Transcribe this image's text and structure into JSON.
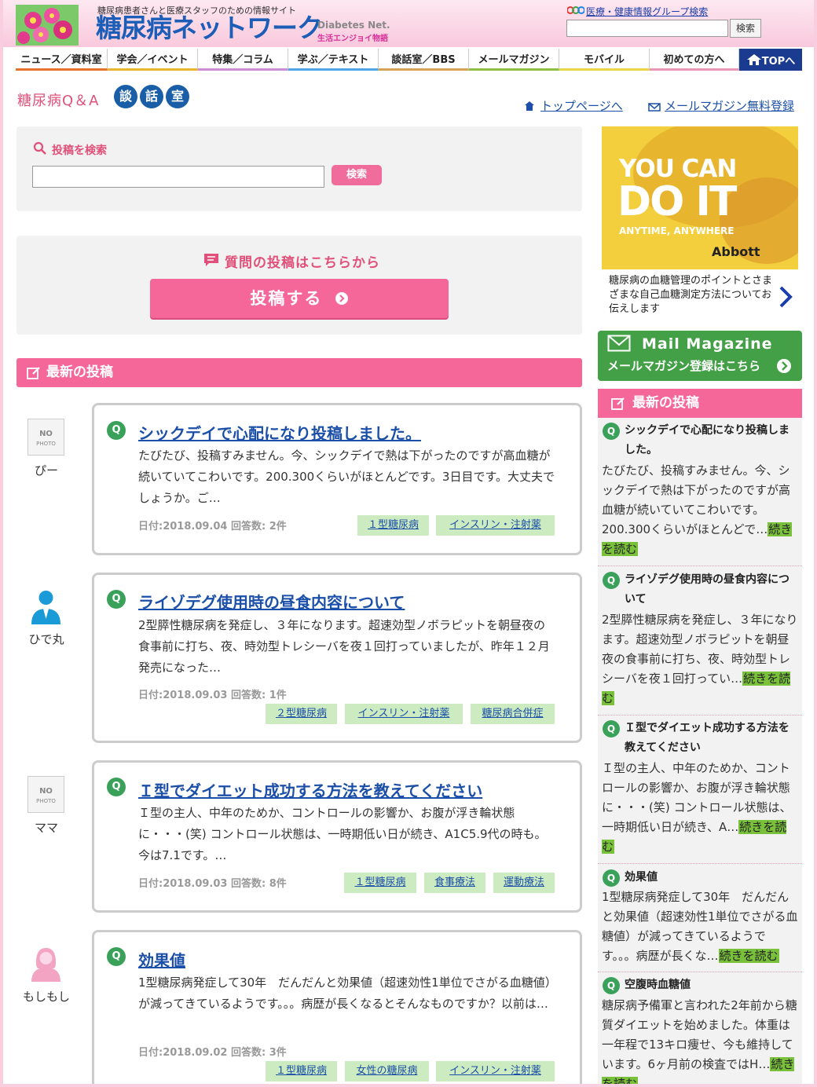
{
  "header": {
    "tagline": "糖尿病患者さんと医療スタッフのための情報サイト",
    "site_name": "糖尿病ネットワーク",
    "sub_en": "Diabetes Net.",
    "sub_jp": "生活エンジョイ物語",
    "group_search_label": "医療・健康情報グループ検索",
    "search_button": "検索"
  },
  "nav": {
    "items": [
      "ニュース／資料室",
      "学会／イベント",
      "特集／コラム",
      "学ぶ／テキスト",
      "談話室／BBS",
      "メールマガジン",
      "モバイル",
      "初めての方へ"
    ],
    "top": "TOPへ",
    "accent_colors": [
      "#e5732d",
      "#e8b62f",
      "#c98fd1",
      "#4fa6e6",
      "#d6a356",
      "#8fc046",
      "#e9d648",
      "#e898b6"
    ]
  },
  "page": {
    "title_prefix": "糖尿病Q＆A",
    "title_chars": [
      "談",
      "話",
      "室"
    ],
    "top_link": "トップページへ",
    "mail_link": "メールマガジン無料登録"
  },
  "search_box": {
    "label": "投稿を検索",
    "button": "検索"
  },
  "post_box": {
    "label": "質問の投稿はこちらから",
    "button": "投稿する"
  },
  "latest": {
    "heading": "最新の投稿",
    "posts": [
      {
        "user": "ぴー",
        "avatar": "no-photo",
        "title": "シックデイで心配になり投稿しました。",
        "body": "たびたび、投稿すみません。今、シックデイで熱は下がったのですが高血糖が続いていてこわいです。200.300くらいがほとんどです。3日目です。大丈夫でしょうか。ご…",
        "meta": "日付:2018.09.04 回答数: 2件",
        "tags": [
          "１型糖尿病",
          "インスリン・注射薬"
        ]
      },
      {
        "user": "ひで丸",
        "avatar": "male",
        "title": "ライゾデグ使用時の昼食内容について",
        "body": "2型膵性糖尿病を発症し、３年になります。超速効型ノボラピットを朝昼夜の食事前に打ち、夜、時効型トレシーバを夜１回打っていましたが、昨年１２月発売になった…",
        "meta": "日付:2018.09.03 回答数: 1件",
        "tags": [
          "２型糖尿病",
          "インスリン・注射薬",
          "糖尿病合併症"
        ]
      },
      {
        "user": "ママ",
        "avatar": "no-photo",
        "title": "Ｉ型でダイエット成功する方法を教えてください",
        "body": "Ｉ型の主人、中年のためか、コントロールの影響か、お腹が浮き輪状態に・・・(笑) コントロール状態は、一時期低い日が続き、A1C5.9代の時も。今は7.1です。…",
        "meta": "日付:2018.09.03 回答数: 8件",
        "tags": [
          "１型糖尿病",
          "食事療法",
          "運動療法"
        ]
      },
      {
        "user": "もしもし",
        "avatar": "female",
        "title": "効果値",
        "body": "1型糖尿病発症して30年　だんだんと効果値（超速効性1単位でさがる血糖値）が減ってきているようです。。。病歴が長くなるとそんなものですか？以前は…",
        "meta": "日付:2018.09.02 回答数: 3件",
        "tags": [
          "１型糖尿病",
          "女性の糖尿病",
          "インスリン・注射薬"
        ]
      }
    ]
  },
  "sidebar": {
    "ad": {
      "headline1": "YOU CAN",
      "headline2": "DO IT",
      "headline3": "ANYTIME, ANYWHERE",
      "brand": "Abbott",
      "text": "糖尿病の血糖管理のポイントとさまざまな自己血糖測定方法についてお伝えします"
    },
    "mail": {
      "title": "Mail Magazine",
      "sub": "メールマガジン登録はこちら"
    },
    "heading": "最新の投稿",
    "more_label": "続きを読む",
    "items": [
      {
        "title": "シックデイで心配になり投稿しました。",
        "body": "たびたび、投稿すみません。今、シックデイで熱は下がったのですが高血糖が続いていてこわいです。200.300くらいがほとんどで…"
      },
      {
        "title": "ライゾデグ使用時の昼食内容について",
        "body": "2型膵性糖尿病を発症し、３年になります。超速効型ノボラピットを朝昼夜の食事前に打ち、夜、時効型トレシーバを夜１回打ってい…"
      },
      {
        "title": "Ｉ型でダイエット成功する方法を教えてください",
        "body": "Ｉ型の主人、中年のためか、コントロールの影響か、お腹が浮き輪状態に・・・(笑) コントロール状態は、一時期低い日が続き、A…"
      },
      {
        "title": "効果値",
        "body": "1型糖尿病発症して30年　だんだんと効果値（超速効性1単位でさがる血糖値）が減ってきているようです。。。病歴が長くな…"
      },
      {
        "title": "空腹時血糖値",
        "body": "糖尿病予備軍と言われた2年前から糖質ダイエットを始めました。体重は一年程で13キロ痩せ、今も維持しています。6ヶ月前の検査ではH…"
      }
    ]
  }
}
